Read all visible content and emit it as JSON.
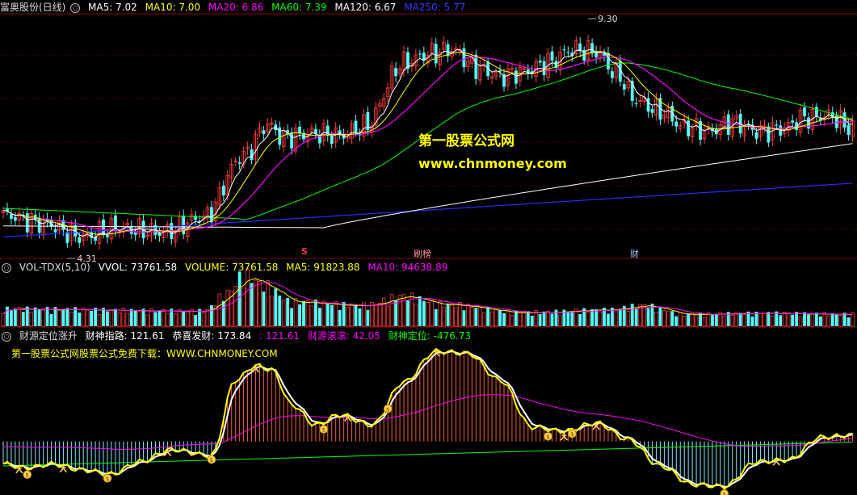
{
  "colors": {
    "up": "#ff3b3b",
    "down": "#54ffff",
    "ma5": "#ffffff",
    "ma10": "#ffff00",
    "ma20": "#ff00ff",
    "ma60": "#00ff00",
    "ma120": "#ffffff",
    "ma250": "#2a2aff",
    "grid": "#8b0000"
  },
  "main_header": {
    "name": "富奥股份(日线)",
    "icon": "circle-marker-icon",
    "ma5": "MA5: 7.02",
    "ma10": "MA10: 7.00",
    "ma20": "MA20: 6.86",
    "ma60": "MA60: 7.39",
    "ma120": "MA120: 6.67",
    "ma250": "MA250: 5.77"
  },
  "watermark": {
    "cn": "第一股票公式网",
    "url": "www.chnmoney.com"
  },
  "markers": {
    "s": "S",
    "bang": "刷榜",
    "cai": "财"
  },
  "vol_header": {
    "name": "VOL-TDX(5,10)",
    "vvol": "VVOL: 73761.58",
    "volume": "VOLUME: 73761.58",
    "ma5": "MA5: 91823.88",
    "ma10": "MA10: 94638.89"
  },
  "ind_header": {
    "name": "财源定位涨升",
    "a": "财神指路: 121.61",
    "b": "恭喜发财: 173.84",
    "c": ": 121.61",
    "d": "财源滚滚: 42.05",
    "e": "财神定位: -476.73",
    "sub": "第一股票公式网股票公式免费下载：WWW.CHNMONEY.COM"
  },
  "chart_data": [
    {
      "type": "candlestick",
      "title": "富奥股份(日线)",
      "annotations": [
        {
          "label": "9.30",
          "type": "high"
        },
        {
          "label": "4.31",
          "type": "low"
        }
      ],
      "close_anchors": [
        {
          "i": 0,
          "v": 5.05
        },
        {
          "i": 10,
          "v": 4.85
        },
        {
          "i": 20,
          "v": 4.55
        },
        {
          "i": 28,
          "v": 4.75
        },
        {
          "i": 40,
          "v": 4.65
        },
        {
          "i": 50,
          "v": 5.0
        },
        {
          "i": 60,
          "v": 6.4
        },
        {
          "i": 66,
          "v": 7.1
        },
        {
          "i": 70,
          "v": 6.8
        },
        {
          "i": 77,
          "v": 6.9
        },
        {
          "i": 84,
          "v": 6.85
        },
        {
          "i": 90,
          "v": 7.05
        },
        {
          "i": 100,
          "v": 8.5
        },
        {
          "i": 106,
          "v": 8.7
        },
        {
          "i": 112,
          "v": 8.8
        },
        {
          "i": 118,
          "v": 8.4
        },
        {
          "i": 124,
          "v": 8.2
        },
        {
          "i": 130,
          "v": 8.3
        },
        {
          "i": 136,
          "v": 8.5
        },
        {
          "i": 142,
          "v": 8.8
        },
        {
          "i": 148,
          "v": 8.75
        },
        {
          "i": 153,
          "v": 8.25
        },
        {
          "i": 158,
          "v": 7.65
        },
        {
          "i": 164,
          "v": 7.4
        },
        {
          "i": 170,
          "v": 7.05
        },
        {
          "i": 176,
          "v": 6.95
        },
        {
          "i": 182,
          "v": 7.15
        },
        {
          "i": 188,
          "v": 6.95
        },
        {
          "i": 194,
          "v": 7.0
        },
        {
          "i": 200,
          "v": 7.25
        },
        {
          "i": 206,
          "v": 7.3
        },
        {
          "i": 212,
          "v": 7.02
        }
      ],
      "ylim": [
        4.1,
        9.6
      ]
    },
    {
      "type": "bar",
      "title": "VOL-TDX(5,10)",
      "volume_anchors": [
        {
          "i": 0,
          "v": 32
        },
        {
          "i": 50,
          "v": 28
        },
        {
          "i": 56,
          "v": 60
        },
        {
          "i": 60,
          "v": 95
        },
        {
          "i": 65,
          "v": 75
        },
        {
          "i": 72,
          "v": 45
        },
        {
          "i": 90,
          "v": 38
        },
        {
          "i": 100,
          "v": 55
        },
        {
          "i": 110,
          "v": 40
        },
        {
          "i": 130,
          "v": 25
        },
        {
          "i": 150,
          "v": 30
        },
        {
          "i": 160,
          "v": 38
        },
        {
          "i": 170,
          "v": 22
        },
        {
          "i": 190,
          "v": 24
        },
        {
          "i": 212,
          "v": 22
        }
      ],
      "ylim": [
        0,
        100
      ]
    },
    {
      "type": "line",
      "title": "财源定位涨升",
      "main_anchors": [
        {
          "i": 0,
          "v": -110
        },
        {
          "i": 6,
          "v": -130
        },
        {
          "i": 12,
          "v": -110
        },
        {
          "i": 20,
          "v": -140
        },
        {
          "i": 27,
          "v": -160
        },
        {
          "i": 34,
          "v": -100
        },
        {
          "i": 42,
          "v": -40
        },
        {
          "i": 52,
          "v": -70
        },
        {
          "i": 58,
          "v": 300
        },
        {
          "i": 63,
          "v": 370
        },
        {
          "i": 67,
          "v": 350
        },
        {
          "i": 72,
          "v": 180
        },
        {
          "i": 78,
          "v": 80
        },
        {
          "i": 84,
          "v": 130
        },
        {
          "i": 92,
          "v": 80
        },
        {
          "i": 100,
          "v": 290
        },
        {
          "i": 108,
          "v": 440
        },
        {
          "i": 116,
          "v": 430
        },
        {
          "i": 124,
          "v": 300
        },
        {
          "i": 132,
          "v": 70
        },
        {
          "i": 140,
          "v": 50
        },
        {
          "i": 148,
          "v": 90
        },
        {
          "i": 156,
          "v": 10
        },
        {
          "i": 164,
          "v": -120
        },
        {
          "i": 172,
          "v": -210
        },
        {
          "i": 180,
          "v": -220
        },
        {
          "i": 188,
          "v": -100
        },
        {
          "i": 196,
          "v": -90
        },
        {
          "i": 204,
          "v": 20
        },
        {
          "i": 212,
          "v": 30
        }
      ],
      "ylim": [
        -250,
        480
      ]
    }
  ]
}
